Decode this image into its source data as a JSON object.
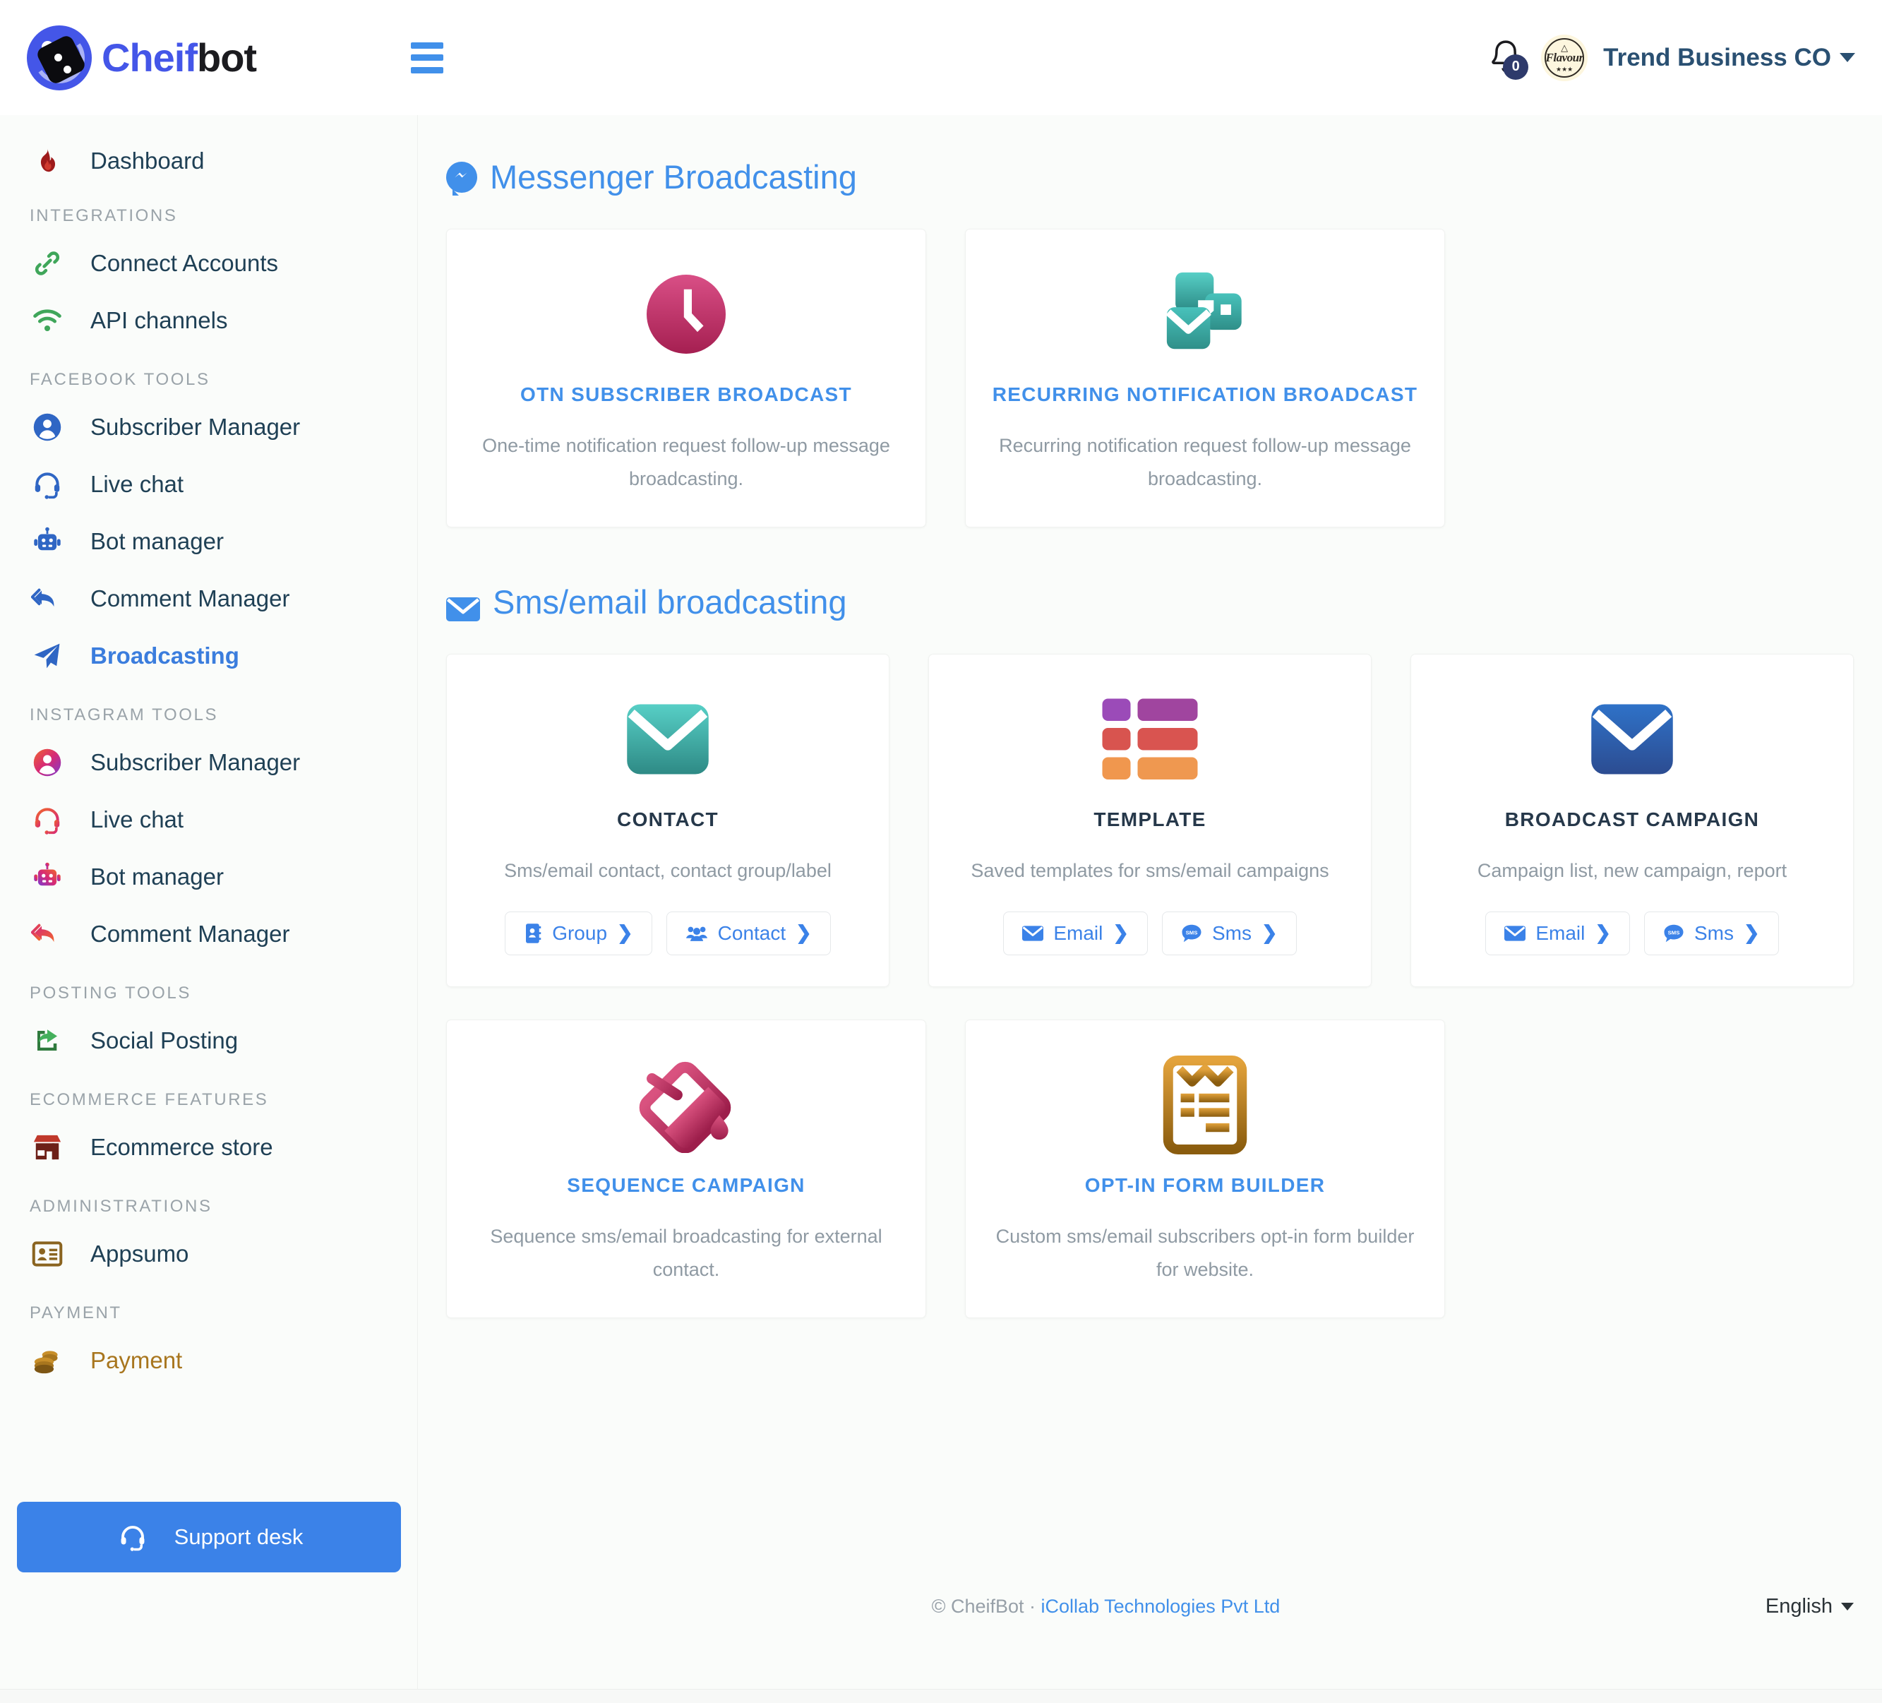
{
  "brand": {
    "part1": "Cheif",
    "part2": "bot"
  },
  "header": {
    "menu_icon": "hamburger-icon",
    "notification_count": "0",
    "avatar_word": "Flavour",
    "avatar_sub": "★★★",
    "org_name": "Trend Business CO"
  },
  "sidebar": {
    "dashboard": {
      "label": "Dashboard",
      "icon": "flame-icon"
    },
    "sections": [
      {
        "title": "INTEGRATIONS",
        "items": [
          {
            "label": "Connect Accounts",
            "icon": "link-icon"
          },
          {
            "label": "API channels",
            "icon": "wifi-icon"
          }
        ]
      },
      {
        "title": "FACEBOOK TOOLS",
        "items": [
          {
            "label": "Subscriber Manager",
            "icon": "user-circle-icon"
          },
          {
            "label": "Live chat",
            "icon": "headset-icon"
          },
          {
            "label": "Bot manager",
            "icon": "robot-icon"
          },
          {
            "label": "Comment Manager",
            "icon": "reply-all-icon"
          },
          {
            "label": "Broadcasting",
            "icon": "paper-plane-icon",
            "active": true
          }
        ]
      },
      {
        "title": "INSTAGRAM TOOLS",
        "items": [
          {
            "label": "Subscriber Manager",
            "icon": "user-circle-icon"
          },
          {
            "label": "Live chat",
            "icon": "headset-icon"
          },
          {
            "label": "Bot manager",
            "icon": "robot-icon"
          },
          {
            "label": "Comment Manager",
            "icon": "reply-all-icon"
          }
        ]
      },
      {
        "title": "POSTING TOOLS",
        "items": [
          {
            "label": "Social Posting",
            "icon": "share-square-icon"
          }
        ]
      },
      {
        "title": "ECOMMERCE FEATURES",
        "items": [
          {
            "label": "Ecommerce store",
            "icon": "store-icon"
          }
        ]
      },
      {
        "title": "ADMINISTRATIONS",
        "items": [
          {
            "label": "Appsumo",
            "icon": "id-card-icon"
          }
        ]
      },
      {
        "title": "PAYMENT",
        "items": [
          {
            "label": "Payment",
            "icon": "coins-icon",
            "tone": "gold"
          }
        ]
      }
    ],
    "support_button": {
      "label": "Support desk",
      "icon": "headset-icon"
    }
  },
  "main": {
    "section_messenger": {
      "title": "Messenger Broadcasting",
      "icon": "messenger-icon",
      "cards": [
        {
          "icon": "clock-circle-icon",
          "title": "OTN SUBSCRIBER BROADCAST",
          "desc": "One-time notification request follow-up message broadcasting."
        },
        {
          "icon": "recurring-cards-envelope-icon",
          "title": "RECURRING NOTIFICATION BROADCAST",
          "desc": "Recurring notification request follow-up message broadcasting."
        }
      ]
    },
    "section_smsemail": {
      "title": "Sms/email broadcasting",
      "icon": "envelope-icon",
      "cards": [
        {
          "icon": "teal-envelope-icon",
          "title": "CONTACT",
          "title_tone": "dark",
          "desc": "Sms/email contact, contact group/label",
          "actions": [
            {
              "label": "Group",
              "icon": "address-book-icon"
            },
            {
              "label": "Contact",
              "icon": "users-icon"
            }
          ]
        },
        {
          "icon": "template-grid-icon",
          "title": "TEMPLATE",
          "title_tone": "dark",
          "desc": "Saved templates for sms/email campaigns",
          "actions": [
            {
              "label": "Email",
              "icon": "envelope-icon"
            },
            {
              "label": "Sms",
              "icon": "sms-bubble-icon"
            }
          ]
        },
        {
          "icon": "blue-envelope-icon",
          "title": "BROADCAST CAMPAIGN",
          "title_tone": "dark",
          "desc": "Campaign list, new campaign, report",
          "actions": [
            {
              "label": "Email",
              "icon": "envelope-icon"
            },
            {
              "label": "Sms",
              "icon": "sms-bubble-icon"
            }
          ]
        },
        {
          "icon": "paint-bucket-icon",
          "title": "SEQUENCE CAMPAIGN",
          "desc": "Sequence sms/email broadcasting for external contact."
        },
        {
          "icon": "form-clipboard-icon",
          "title": "OPT-IN FORM BUILDER",
          "desc": "Custom sms/email subscribers opt-in form builder for website."
        }
      ]
    }
  },
  "footer": {
    "copyright": "© CheifBot  ·  ",
    "company": "iCollab Technologies Pvt Ltd",
    "language": "English"
  },
  "colors": {
    "accent_blue": "#4190ea",
    "brand_blue": "#4456e8",
    "sidebar_text": "#1f4055",
    "gold": "#a8761e"
  }
}
